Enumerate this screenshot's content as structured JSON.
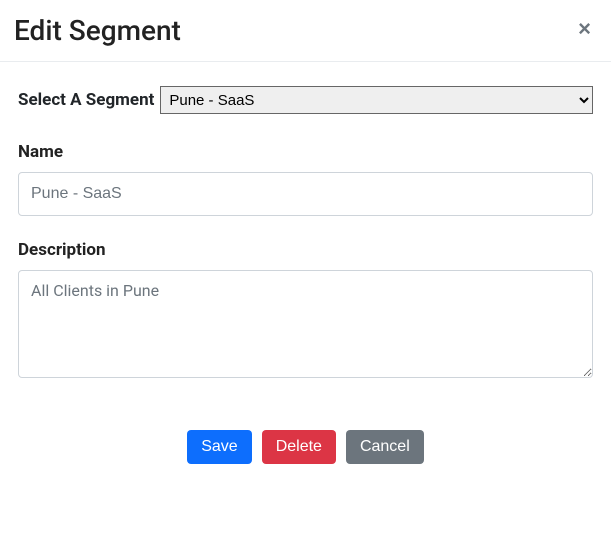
{
  "header": {
    "title": "Edit Segment",
    "close_glyph": "×"
  },
  "form": {
    "select_label": "Select A Segment",
    "selected_segment": "Pune - SaaS",
    "name_label": "Name",
    "name_value": "Pune - SaaS",
    "description_label": "Description",
    "description_value": "All Clients in Pune"
  },
  "actions": {
    "save": "Save",
    "delete": "Delete",
    "cancel": "Cancel"
  }
}
